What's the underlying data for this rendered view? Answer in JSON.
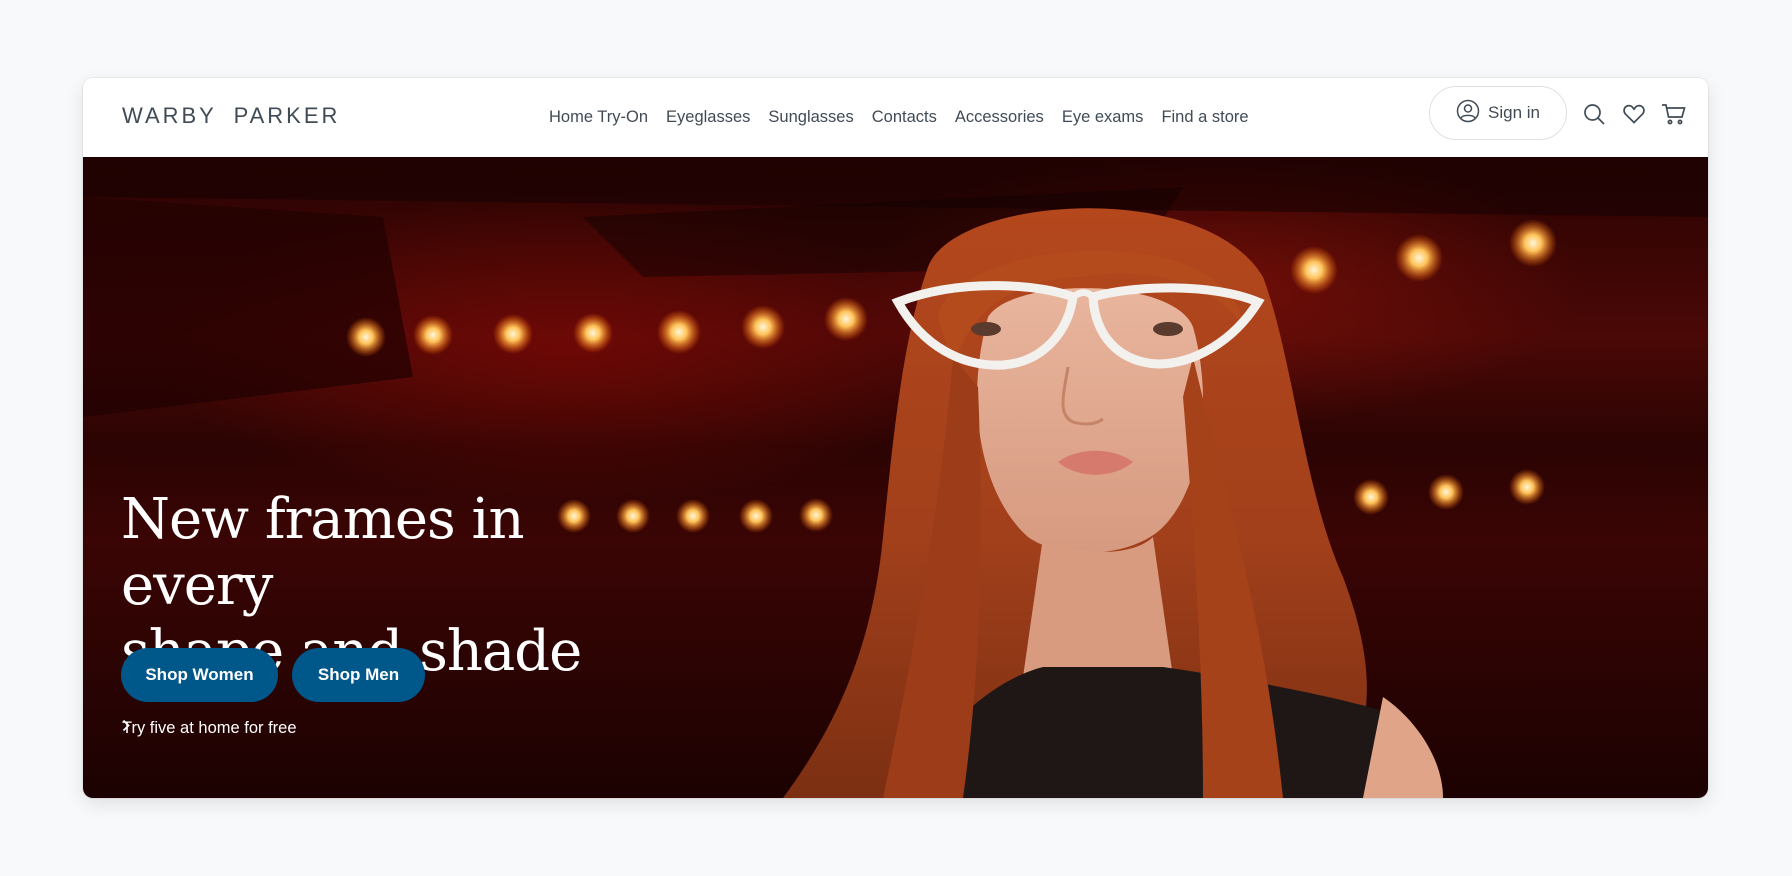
{
  "brand": {
    "logo_text": "WARBY PARKER"
  },
  "nav": {
    "links": [
      "Home Try-On",
      "Eyeglasses",
      "Sunglasses",
      "Contacts",
      "Accessories",
      "Eye exams",
      "Find a store"
    ],
    "sign_in_label": "Sign in"
  },
  "icons": {
    "account": "user-circle-icon",
    "search": "search-icon",
    "favorites": "heart-icon",
    "cart": "cart-icon",
    "link_chevron": "chevron-right-icon"
  },
  "hero": {
    "headline_line1": "New frames in every",
    "headline_line2": "shape and shade",
    "cta_women": "Shop Women",
    "cta_men": "Shop Men",
    "try_link": "Try five at home for free"
  },
  "colors": {
    "cta_blue": "#00578a",
    "nav_text": "#414b56",
    "hero_bg_red": "#4a0806"
  }
}
